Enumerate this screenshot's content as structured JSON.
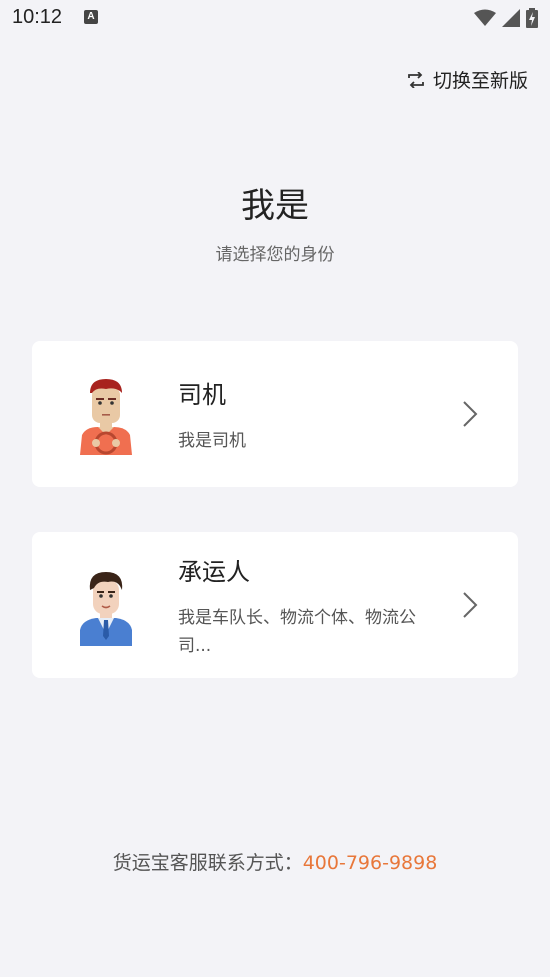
{
  "status_bar": {
    "time": "10:12",
    "notification_icon": "a-notification-icon",
    "icons": [
      "wifi-icon",
      "signal-icon",
      "battery-charging-icon"
    ]
  },
  "header": {
    "switch_label": "切换至新版",
    "switch_icon": "swap-icon"
  },
  "main": {
    "title": "我是",
    "subtitle": "请选择您的身份"
  },
  "roles": [
    {
      "title": "司机",
      "description": "我是司机",
      "icon": "driver-avatar-icon"
    },
    {
      "title": "承运人",
      "description": "我是车队长、物流个体、物流公司...",
      "icon": "carrier-avatar-icon"
    }
  ],
  "footer": {
    "label": "货运宝客服联系方式：",
    "phone": "400-796-9898"
  },
  "colors": {
    "background": "#f3f3f7",
    "card": "#ffffff",
    "accent": "#e8773a",
    "driver_shirt": "#f06f50",
    "carrier_shirt": "#4a7fd1"
  }
}
